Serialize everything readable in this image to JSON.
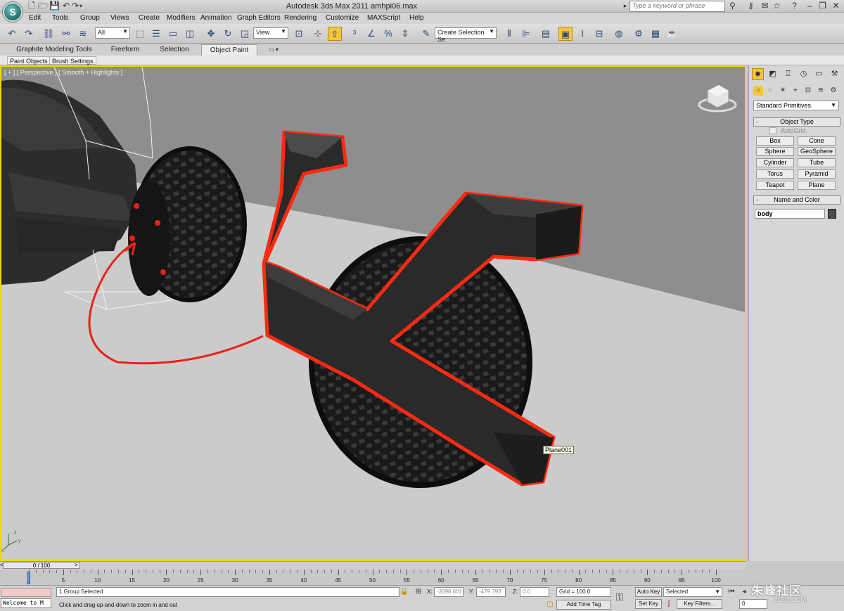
{
  "window": {
    "title": "Autodesk 3ds Max  2011      amhpi06.max",
    "help_search_placeholder": "Type a keyword or phrase"
  },
  "menu": [
    "Edit",
    "Tools",
    "Group",
    "Views",
    "Create",
    "Modifiers",
    "Animation",
    "Graph Editors",
    "Rendering",
    "Customize",
    "MAXScript",
    "Help"
  ],
  "toolbar": {
    "selection_filter": "All",
    "ref_coord": "View",
    "named_selection_placeholder": "Create Selection Se"
  },
  "ribbon": {
    "tabs": [
      "Graphite Modeling Tools",
      "Freeform",
      "Selection",
      "Object Paint"
    ],
    "active_tab": "Object Paint",
    "sub_buttons": [
      "Paint Objects",
      "Brush Settings"
    ]
  },
  "viewport": {
    "label": "[ + ] [ Perspective ] [ Smooth + Highlights ]",
    "tooltip": "Plane001"
  },
  "command_panel": {
    "category": "Standard Primitives",
    "object_type_title": "Object Type",
    "autogrid_label": "AutoGrid",
    "primitives": [
      "Box",
      "Cone",
      "Sphere",
      "GeoSphere",
      "Cylinder",
      "Tube",
      "Torus",
      "Pyramid",
      "Teapot",
      "Plane"
    ],
    "name_color_title": "Name and Color",
    "object_name": "body",
    "object_color": "#4a4a4a"
  },
  "timeline": {
    "frame_display": "0 / 100",
    "ticks": [
      "0",
      "5",
      "10",
      "15",
      "20",
      "25",
      "30",
      "35",
      "40",
      "45",
      "50",
      "55",
      "60",
      "65",
      "70",
      "75",
      "80",
      "85",
      "90",
      "95",
      "100"
    ]
  },
  "status": {
    "listener_text": "Welcome to M",
    "selection": "1 Group Selected",
    "prompt": "Click and drag up-and-down to zoom in and out",
    "x_label": "X:",
    "x_value": "-3098.601",
    "y_label": "Y:",
    "y_value": "-479.793",
    "z_label": "Z:",
    "z_value": "0.0",
    "grid": "Grid = 100.0",
    "add_time_tag": "Add Time Tag",
    "auto_key": "Auto Key",
    "set_key": "Set Key",
    "key_mode": "Selected",
    "key_filters": "Key Filters...",
    "current_frame": "0"
  },
  "watermark": {
    "text": "朱峰社区",
    "sub": "ZF3D.COM"
  },
  "colors": {
    "viewport_border": "#f0d800",
    "highlight_outline": "#ff2a12",
    "active_tool": "#f5c542"
  }
}
